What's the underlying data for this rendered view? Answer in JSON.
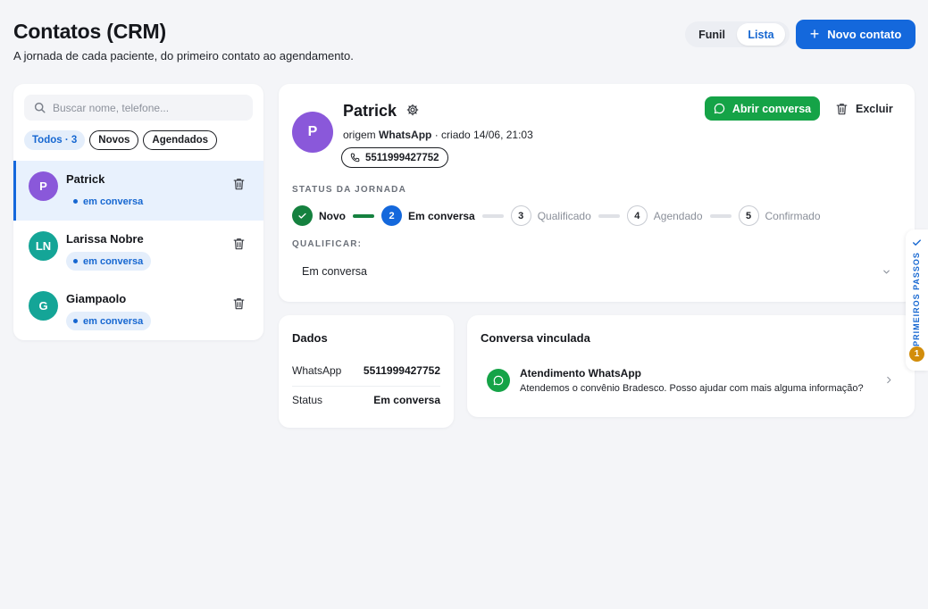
{
  "header": {
    "title": "Contatos (CRM)",
    "subtitle": "A jornada de cada paciente, do primeiro contato ao agendamento."
  },
  "view_toggle": {
    "funil": "Funil",
    "lista": "Lista",
    "active": "Lista"
  },
  "new_contact_label": "Novo contato",
  "search": {
    "placeholder": "Buscar nome, telefone...",
    "value": ""
  },
  "filters": {
    "all": "Todos · 3",
    "new": "Novos",
    "scheduled": "Agendados"
  },
  "contacts": [
    {
      "initials": "P",
      "name": "Patrick",
      "status": "em conversa",
      "color": "#8a58da",
      "selected": true
    },
    {
      "initials": "LN",
      "name": "Larissa Nobre",
      "status": "em conversa",
      "color": "#14a597",
      "selected": false
    },
    {
      "initials": "G",
      "name": "Giampaolo",
      "status": "em conversa",
      "color": "#14a597",
      "selected": false
    }
  ],
  "detail": {
    "initials": "P",
    "name": "Patrick",
    "origin_prefix": "origem",
    "origin_source": "WhatsApp",
    "origin_suffix": "· criado 14/06, 21:03",
    "phone": "5511999427752",
    "open_conversation_label": "Abrir conversa",
    "delete_label": "Excluir",
    "journey_label": "STATUS DA JORNADA",
    "steps": [
      {
        "marker": "",
        "label": "Novo",
        "state": "done"
      },
      {
        "marker": "2",
        "label": "Em conversa",
        "state": "current"
      },
      {
        "marker": "3",
        "label": "Qualificado",
        "state": "pending"
      },
      {
        "marker": "4",
        "label": "Agendado",
        "state": "pending"
      },
      {
        "marker": "5",
        "label": "Confirmado",
        "state": "pending"
      }
    ],
    "qualify_label": "QUALIFICAR:",
    "qualify_value": "Em conversa"
  },
  "data_card": {
    "title": "Dados",
    "rows": [
      {
        "key": "WhatsApp",
        "value": "5511999427752"
      },
      {
        "key": "Status",
        "value": "Em conversa"
      }
    ]
  },
  "conversation_card": {
    "title": "Conversa vinculada",
    "item_title": "Atendimento WhatsApp",
    "item_preview": "Atendemos o convênio Bradesco. Posso ajudar com mais alguma informação?"
  },
  "side_tab": {
    "label": "PRIMEIROS PASSOS",
    "count": "1"
  },
  "colors": {
    "primary": "#1468dc",
    "whatsapp_green": "#15a347",
    "done_green": "#15813f",
    "badge_bg": "#e4eefb",
    "onboarding_badge": "#d28d0b"
  }
}
